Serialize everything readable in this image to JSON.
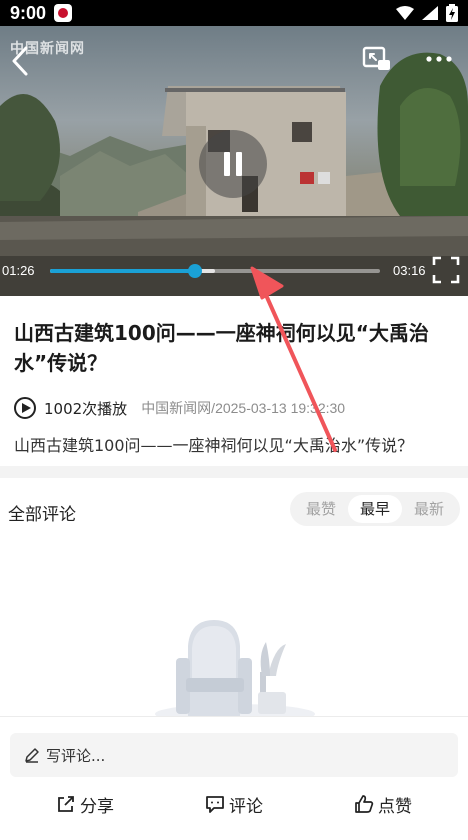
{
  "status_bar": {
    "time": "9:00",
    "icons": [
      "app-notification-icon",
      "wifi-icon",
      "signal-icon",
      "battery-charging-icon"
    ]
  },
  "video": {
    "watermark": "中国新闻网",
    "current_time": "01:26",
    "total_time": "03:16",
    "progress_fraction": 0.44,
    "buffer_fraction": 0.5,
    "state": "playing",
    "accent_color": "#1aa1d6",
    "icons": [
      "back-icon",
      "picture-in-picture-icon",
      "more-icon",
      "pause-icon",
      "fullscreen-icon"
    ]
  },
  "article": {
    "title": "山西古建筑100问——一座神祠何以见“大禹治水”传说？",
    "play_count": "1002次播放",
    "source_date": "中国新闻网/2025-03-13 19:32:30",
    "summary": "山西古建筑100问——一座神祠何以见“大禹治水”传说？"
  },
  "comments": {
    "heading": "全部评论",
    "sort_tabs": [
      {
        "label": "最赞",
        "active": false
      },
      {
        "label": "最早",
        "active": true
      },
      {
        "label": "最新",
        "active": false
      }
    ]
  },
  "bottom_bar": {
    "comment_placeholder": "写评论...",
    "share_label": "分享",
    "comment_label": "评论",
    "like_label": "点赞"
  },
  "annotation": {
    "color": "#f0555a"
  }
}
